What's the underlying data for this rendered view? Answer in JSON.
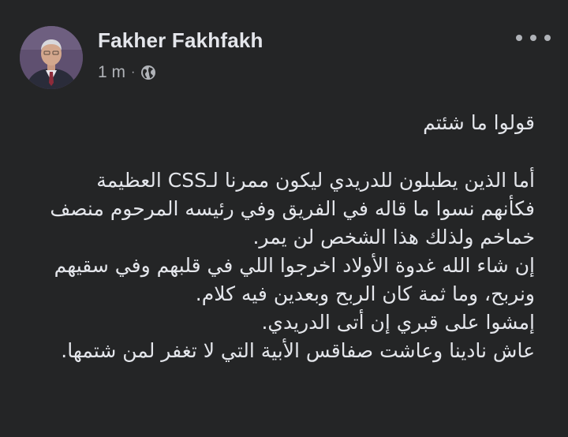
{
  "post": {
    "author": "Fakher Fakhfakh",
    "time": "1 m",
    "separator": "·",
    "audience_icon": "globe-icon",
    "more_icon": "more-options-icon",
    "lines": [
      "قولوا ما شئتم",
      "أما الذين يطبلون للدريدي ليكون ممرنا لـCSS العظيمة",
      "فكأنهم نسوا ما قاله في الفريق وفي رئيسه المرحوم منصف",
      "خماخم ولذلك هذا الشخص لن يمر.",
      "إن شاء الله غدوة الأولاد اخرجوا اللي في قلبهم وفي سقيهم",
      "ونربح، وما ثمة كان الربح وبعدين فيه كلام.",
      "إمشوا على قبري إن أتى الدريدي.",
      "عاش نادينا وعاشت صفاقس الأبية التي لا تغفر لمن شتمها."
    ]
  },
  "colors": {
    "background": "#242526",
    "text": "#e4e6eb",
    "secondary_text": "#b0b3b8"
  }
}
